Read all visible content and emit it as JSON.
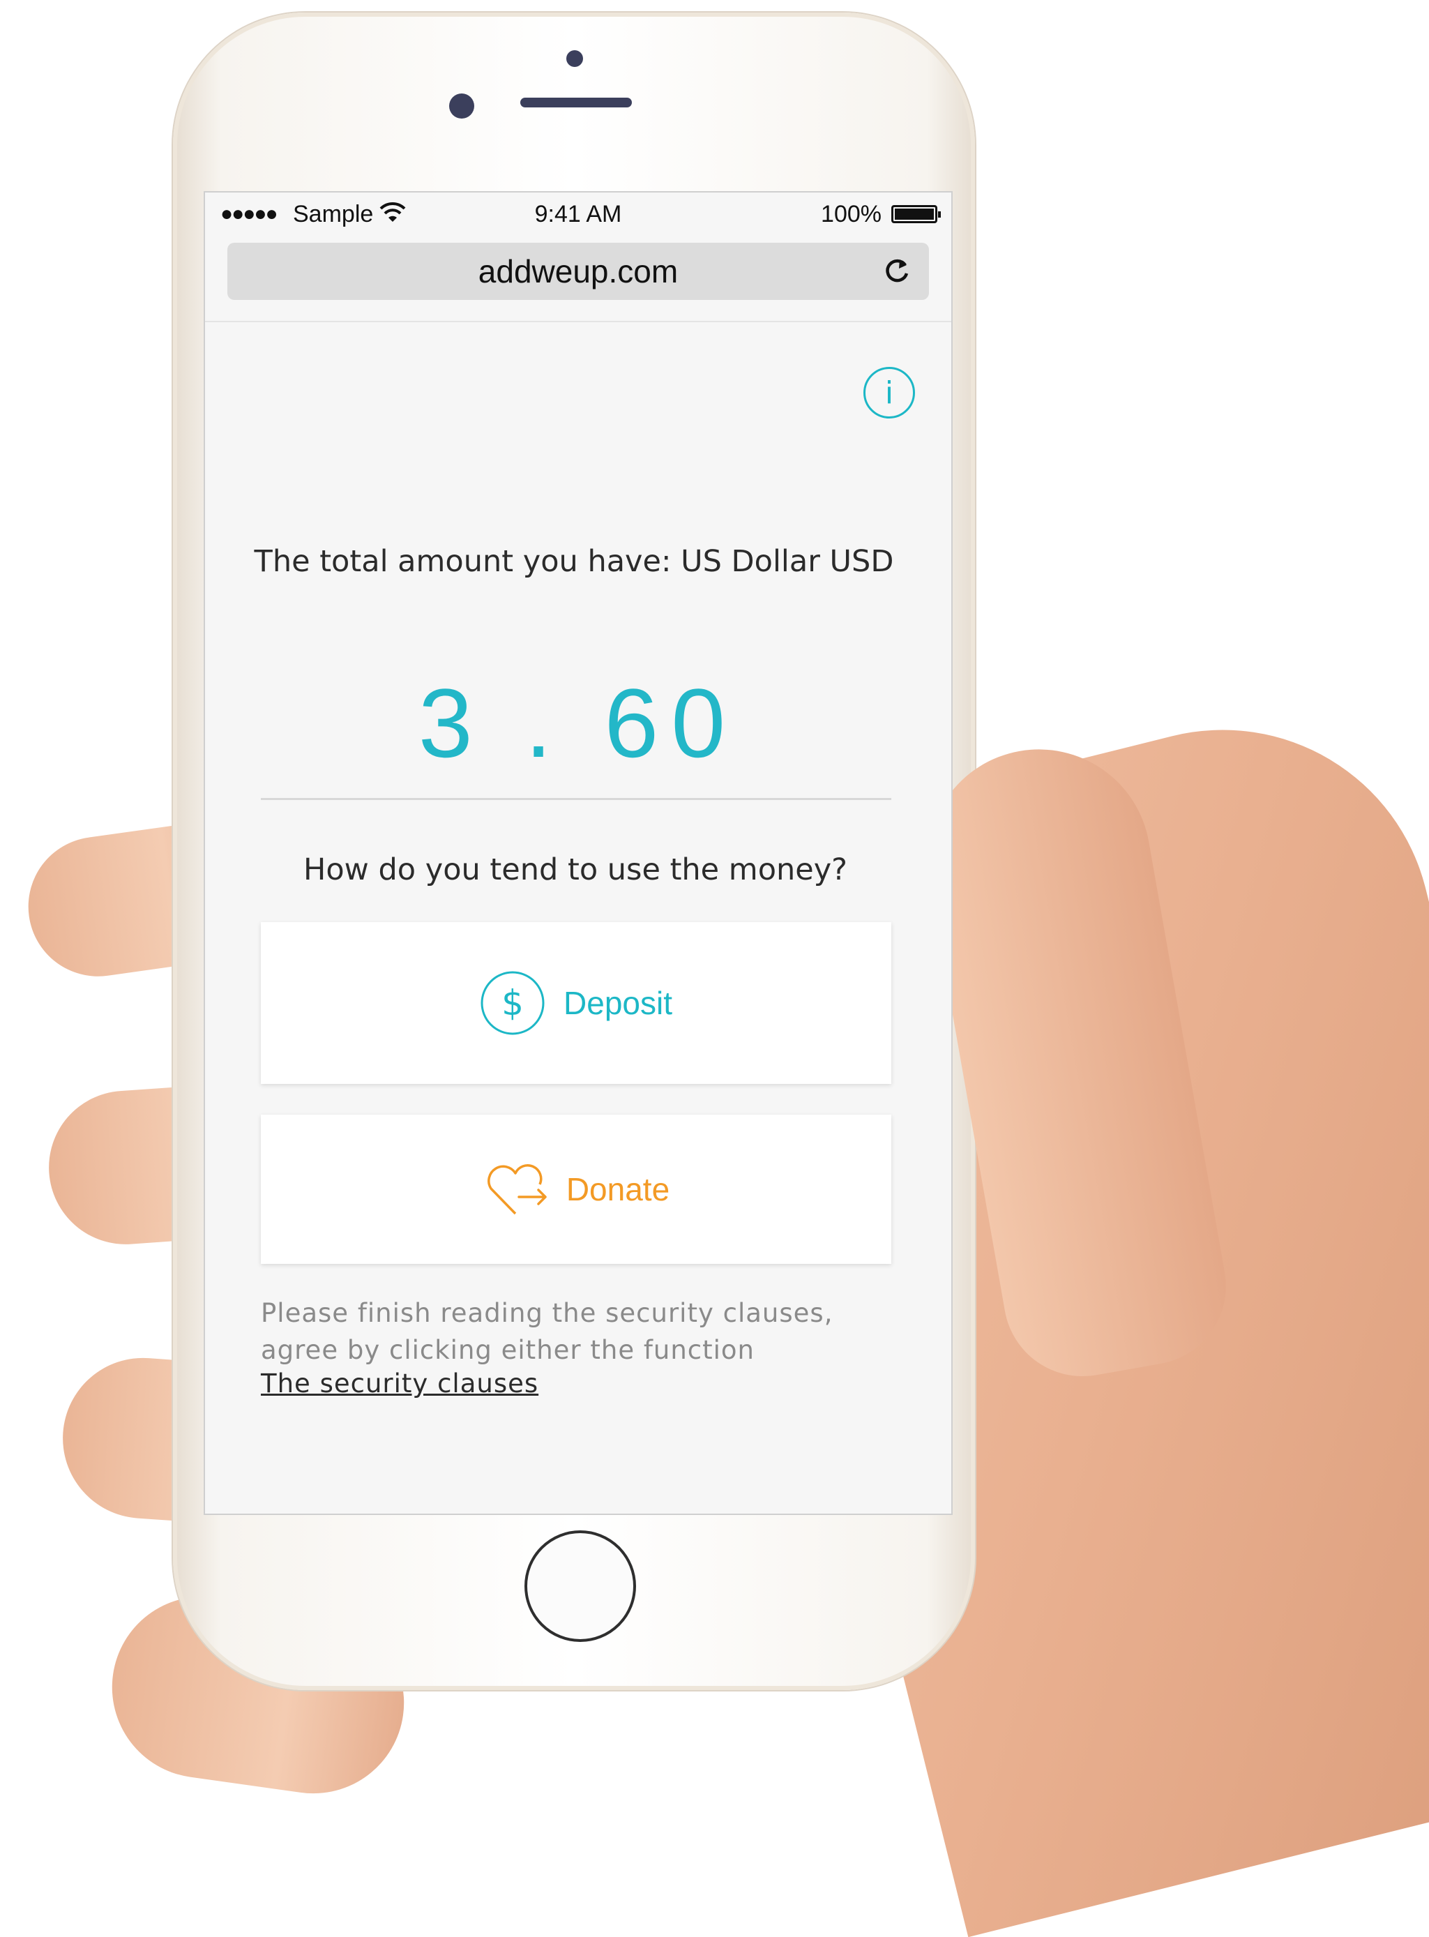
{
  "status_bar": {
    "signal": "●●●●●",
    "carrier": "Sample",
    "time": "9:41 AM",
    "battery": "100%",
    "battery_level": 1.0
  },
  "browser": {
    "url": "addweup.com"
  },
  "page": {
    "total_label": "The total amount you have: US Dollar USD",
    "amount": "3 . 60",
    "question": "How do you tend to use the money?",
    "options": [
      {
        "label": "Deposit",
        "icon": "dollar-circle-icon",
        "color": "#1cb7c6"
      },
      {
        "label": "Donate",
        "icon": "heart-arrow-icon",
        "color": "#f39a25"
      }
    ],
    "note_line1": "Please finish reading the security clauses,",
    "note_line2": "agree by clicking either the function",
    "security_link": "The security clauses"
  },
  "colors": {
    "accent": "#1cb7c6",
    "donate": "#f39a25"
  }
}
